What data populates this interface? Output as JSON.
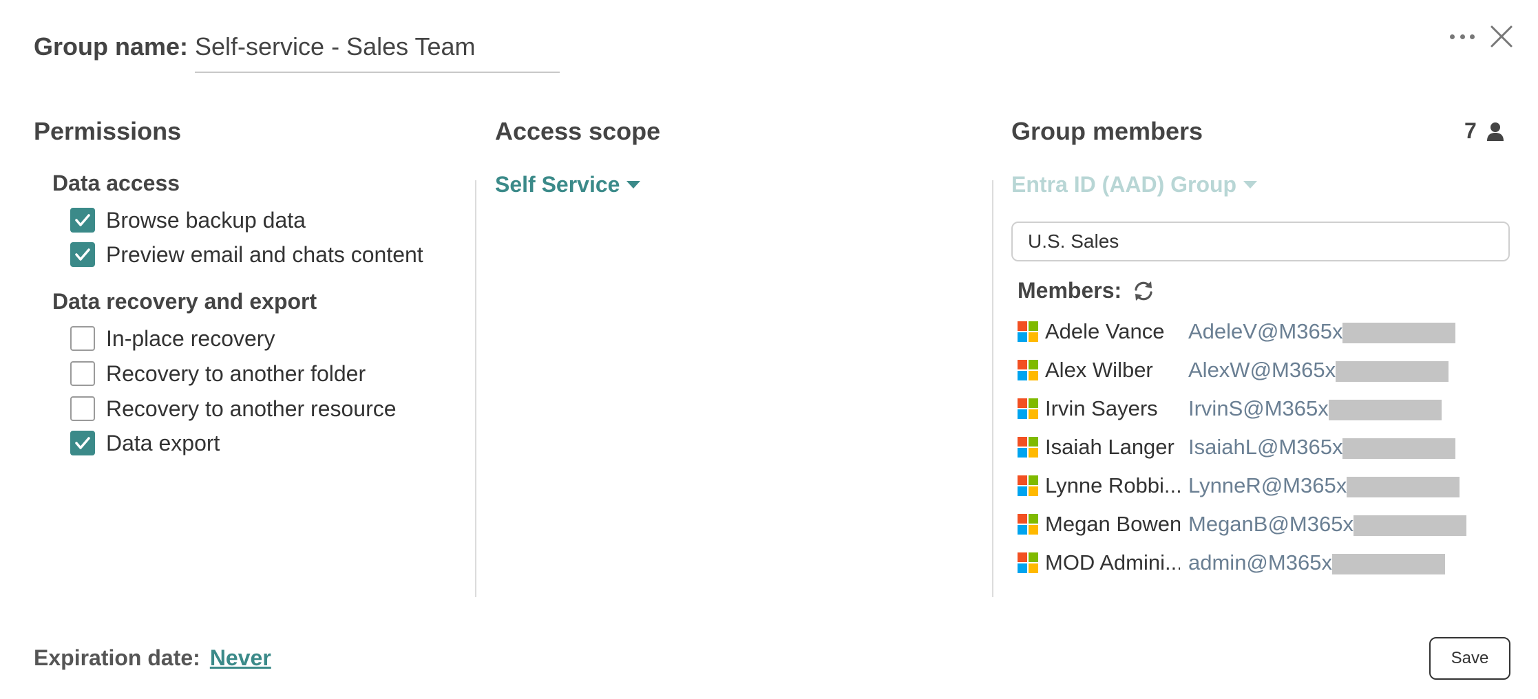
{
  "header": {
    "group_name_label": "Group name:",
    "group_name_value": "Self-service - Sales Team"
  },
  "permissions": {
    "title": "Permissions",
    "data_access": {
      "heading": "Data access",
      "items": [
        {
          "label": "Browse backup data",
          "checked": true
        },
        {
          "label": "Preview email and chats content",
          "checked": true
        }
      ]
    },
    "recovery": {
      "heading": "Data recovery and export",
      "items": [
        {
          "label": "In-place recovery",
          "checked": false
        },
        {
          "label": "Recovery to another folder",
          "checked": false
        },
        {
          "label": "Recovery to another resource",
          "checked": false
        },
        {
          "label": "Data export",
          "checked": true
        }
      ]
    }
  },
  "access_scope": {
    "title": "Access scope",
    "selected": "Self Service"
  },
  "group_members": {
    "title": "Group members",
    "count": "7",
    "source": "Entra ID (AAD) Group",
    "search_value": "U.S. Sales",
    "members_label": "Members:",
    "members": [
      {
        "name": "Adele Vance",
        "email": "AdeleV@M365x"
      },
      {
        "name": "Alex Wilber",
        "email": "AlexW@M365x"
      },
      {
        "name": "Irvin Sayers",
        "email": "IrvinS@M365x"
      },
      {
        "name": "Isaiah Langer",
        "email": "IsaiahL@M365x"
      },
      {
        "name": "Lynne Robbi...",
        "email": "LynneR@M365x"
      },
      {
        "name": "Megan Bowen",
        "email": "MeganB@M365x"
      },
      {
        "name": "MOD Admini...",
        "email": "admin@M365x"
      }
    ]
  },
  "footer": {
    "expiration_label": "Expiration date:",
    "expiration_value": "Never",
    "save_label": "Save"
  },
  "colors": {
    "accent": "#3b8a89",
    "accent_light": "#b8d6d5",
    "email": "#6a7f93",
    "ms_red": "#f25022",
    "ms_green": "#7fba00",
    "ms_blue": "#00a4ef",
    "ms_yellow": "#ffb900"
  }
}
